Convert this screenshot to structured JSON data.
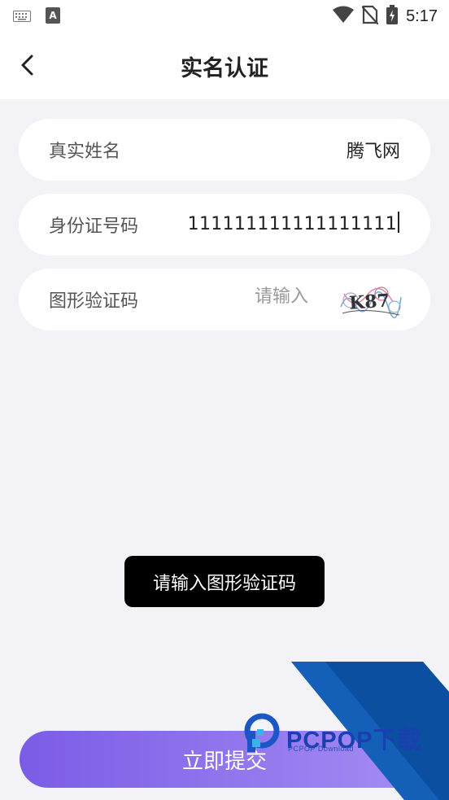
{
  "status_bar": {
    "time": "5:17",
    "icons": [
      "keyboard-icon",
      "a-box-icon",
      "wifi-icon",
      "no-sim-icon",
      "battery-charging-icon"
    ]
  },
  "app_bar": {
    "title": "实名认证",
    "back_icon": "chevron-left-icon"
  },
  "form": {
    "name": {
      "label": "真实姓名",
      "value": "腾飞网"
    },
    "id_number": {
      "label": "身份证号码",
      "value": "111111111111111111"
    },
    "captcha": {
      "label": "图形验证码",
      "placeholder": "请输入",
      "value": "",
      "image_text": "K87"
    }
  },
  "toast": {
    "text": "请输入图形验证码"
  },
  "submit": {
    "label": "立即提交"
  },
  "watermark": {
    "brand": "PCPOP下载",
    "sub": "PCPOP Download"
  },
  "colors": {
    "accent_start": "#7b5ce6",
    "accent_end": "#a58df3",
    "watermark_blue": "#0a4fa0"
  }
}
